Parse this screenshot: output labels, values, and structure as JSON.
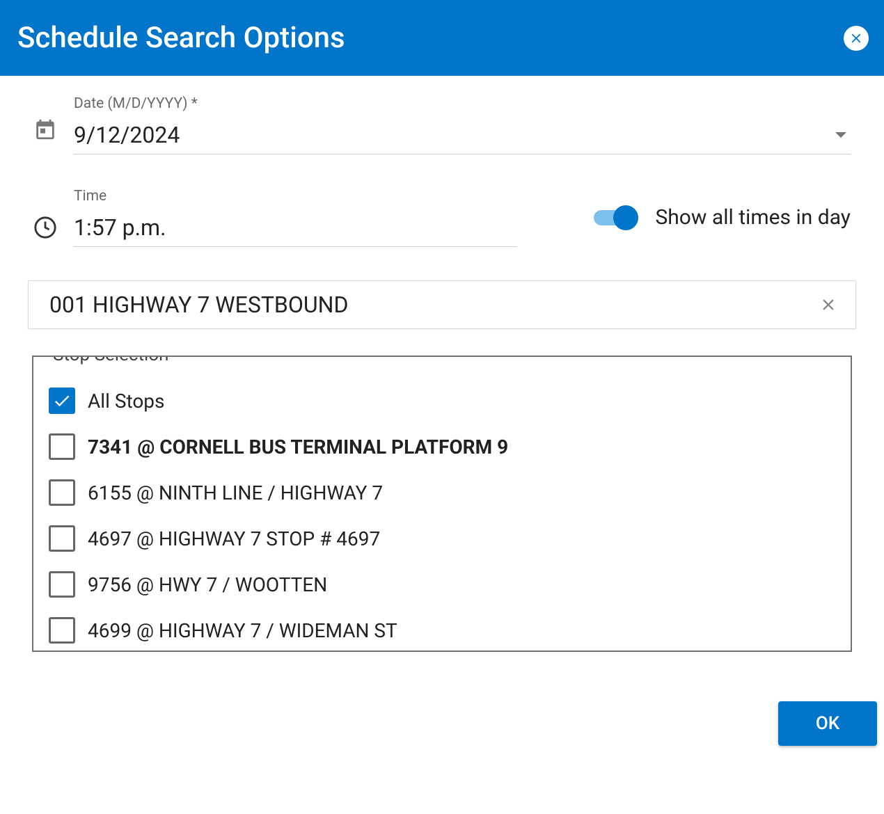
{
  "header": {
    "title": "Schedule Search Options"
  },
  "date": {
    "label": "Date (M/D/YYYY) *",
    "value": "9/12/2024"
  },
  "time": {
    "label": "Time",
    "value": "1:57 p.m."
  },
  "toggle": {
    "label": "Show all times in day",
    "on": true
  },
  "route": {
    "value": "001 HIGHWAY 7 WESTBOUND"
  },
  "stopSelection": {
    "legend": "Stop Selection",
    "allStops": {
      "label": "All Stops",
      "checked": true
    },
    "stops": [
      {
        "label": "7341 @ CORNELL BUS TERMINAL PLATFORM 9",
        "checked": false,
        "bold": true
      },
      {
        "label": "6155 @ NINTH LINE / HIGHWAY 7",
        "checked": false,
        "bold": false
      },
      {
        "label": "4697 @ HIGHWAY 7 STOP # 4697",
        "checked": false,
        "bold": false
      },
      {
        "label": "9756 @ HWY 7 / WOOTTEN",
        "checked": false,
        "bold": false
      },
      {
        "label": "4699 @ HIGHWAY 7 / WIDEMAN ST",
        "checked": false,
        "bold": false
      }
    ]
  },
  "buttons": {
    "ok": "OK"
  }
}
